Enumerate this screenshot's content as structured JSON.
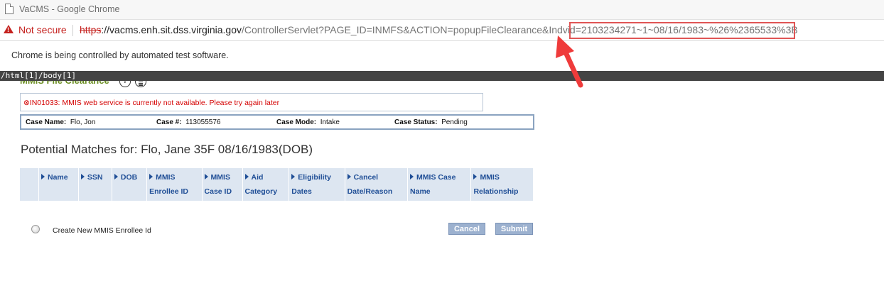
{
  "window": {
    "title": "VaCMS - Google Chrome"
  },
  "addressbar": {
    "security_label": "Not secure",
    "url_scheme": "https",
    "url_host": "://vacms.enh.sit.dss.virginia.gov",
    "url_path": "/ControllerServlet?PAGE_ID=INMFS&ACTION=popupFileClearance&Indvid=",
    "url_param_value": "2103234271~1~08/16/1983~%26%2365533%3B"
  },
  "infobar": {
    "text": "Chrome is being controlled by automated test software."
  },
  "xpath": {
    "text": "/html[1]/body[1]"
  },
  "page": {
    "section_title": "MMIS File Clearance",
    "help_glyph": "?",
    "error_message": "⊗IN01033: MMIS web service is currently not available. Please try again later",
    "case": {
      "name_label": "Case Name:",
      "name_value": "Flo, Jon",
      "number_label": "Case #:",
      "number_value": "113055576",
      "mode_label": "Case Mode:",
      "mode_value": "Intake",
      "status_label": "Case Status:",
      "status_value": "Pending"
    },
    "matches_title": "Potential Matches for: Flo, Jane 35F 08/16/1983(DOB)",
    "table": {
      "columns": [
        {
          "l1": "Name",
          "l2": ""
        },
        {
          "l1": "SSN",
          "l2": ""
        },
        {
          "l1": "DOB",
          "l2": ""
        },
        {
          "l1": "MMIS",
          "l2": "Enrollee ID"
        },
        {
          "l1": "MMIS",
          "l2": "Case ID"
        },
        {
          "l1": "Aid",
          "l2": "Category"
        },
        {
          "l1": "Eligibility",
          "l2": "Dates"
        },
        {
          "l1": "Cancel",
          "l2": "Date/Reason"
        },
        {
          "l1": "MMIS Case",
          "l2": "Name"
        },
        {
          "l1": "MMIS",
          "l2": "Relationship"
        }
      ]
    },
    "create_new_label": "Create New MMIS Enrollee Id",
    "cancel_label": "Cancel",
    "submit_label": "Submit"
  },
  "colors": {
    "annotation_red": "#e05555",
    "header_blue": "#1f4e96",
    "title_green": "#6b8e23",
    "error_red": "#d40000"
  }
}
